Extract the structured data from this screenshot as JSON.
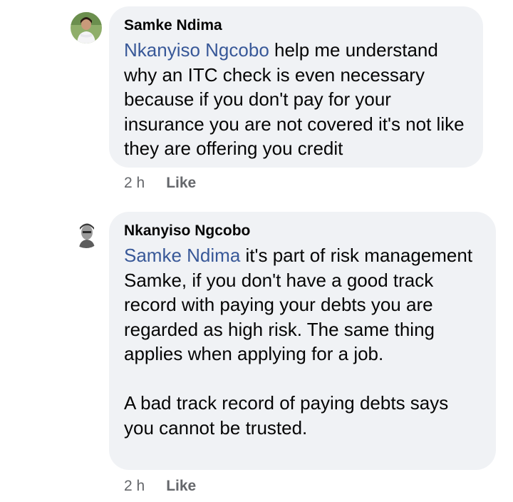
{
  "comments": [
    {
      "author": "Samke Ndima",
      "mention": "Nkanyiso Ngcobo",
      "text": " help me understand why an ITC check is even necessary because if you don't pay for your insurance you are not covered it's not like they are offering you credit",
      "time": "2 h",
      "like_label": "Like"
    },
    {
      "author": "Nkanyiso Ngcobo",
      "mention": "Samke Ndima",
      "text": " it's part of risk management Samke, if you don't have a good track record with paying your debts you are regarded as high risk. The same thing applies when applying for a job.\n\nA bad track record of paying debts says you cannot be trusted.",
      "time": "2 h",
      "like_label": "Like"
    }
  ],
  "colors": {
    "bubble_bg": "#f0f2f5",
    "mention": "#385898",
    "meta_text": "#65676b",
    "primary_text": "#050505"
  }
}
